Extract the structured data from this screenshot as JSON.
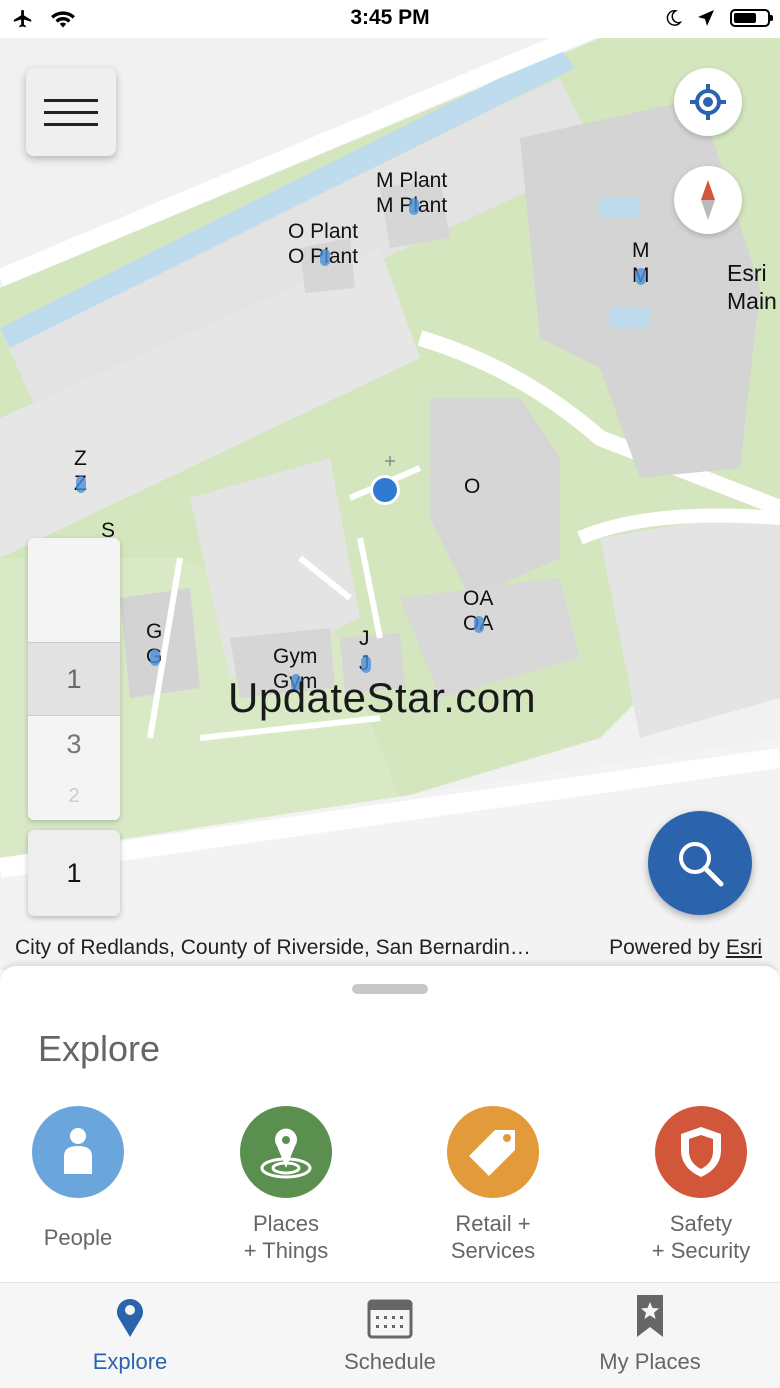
{
  "status_bar": {
    "time": "3:45 PM",
    "left_icons": [
      "airplane-icon",
      "wifi-icon"
    ],
    "right_icons": [
      "moon-icon",
      "location-arrow-icon",
      "battery-icon"
    ]
  },
  "map": {
    "labels": {
      "m_plant": "M Plant",
      "o_plant": "O Plant",
      "m": "M",
      "esri_main_line1": "Esri",
      "esri_main_line2": "Main",
      "z": "Z",
      "s": "S",
      "o": "O",
      "oa": "OA",
      "g": "G",
      "j": "J",
      "gym": "Gym"
    },
    "watermark": "UpdateStar.com",
    "floor_picker": {
      "items": [
        "1",
        "3",
        "2"
      ],
      "selected": "1",
      "current": "1"
    },
    "attribution": "City of Redlands, County of Riverside, San Bernardin…",
    "powered_by": "Powered by",
    "powered_by_link": "Esri"
  },
  "explore": {
    "title": "Explore",
    "categories": [
      {
        "label_line1": "People",
        "label_line2": "",
        "icon": "person-icon",
        "color": "#6aa6dc"
      },
      {
        "label_line1": "Places",
        "label_line2": "+ Things",
        "icon": "place-pin-icon",
        "color": "#5b8f4f"
      },
      {
        "label_line1": "Retail +",
        "label_line2": "Services",
        "icon": "tag-icon",
        "color": "#e39a3b"
      },
      {
        "label_line1": "Safety",
        "label_line2": "+ Security",
        "icon": "shield-icon",
        "color": "#d2573a"
      }
    ]
  },
  "tabs": [
    {
      "label": "Explore",
      "icon": "map-pin-icon",
      "active": true
    },
    {
      "label": "Schedule",
      "icon": "calendar-icon",
      "active": false
    },
    {
      "label": "My Places",
      "icon": "bookmark-star-icon",
      "active": false
    }
  ],
  "colors": {
    "accent": "#2b64ad",
    "park": "#cfe3b9",
    "building": "#d6d6d6",
    "water": "#bfdcef"
  }
}
